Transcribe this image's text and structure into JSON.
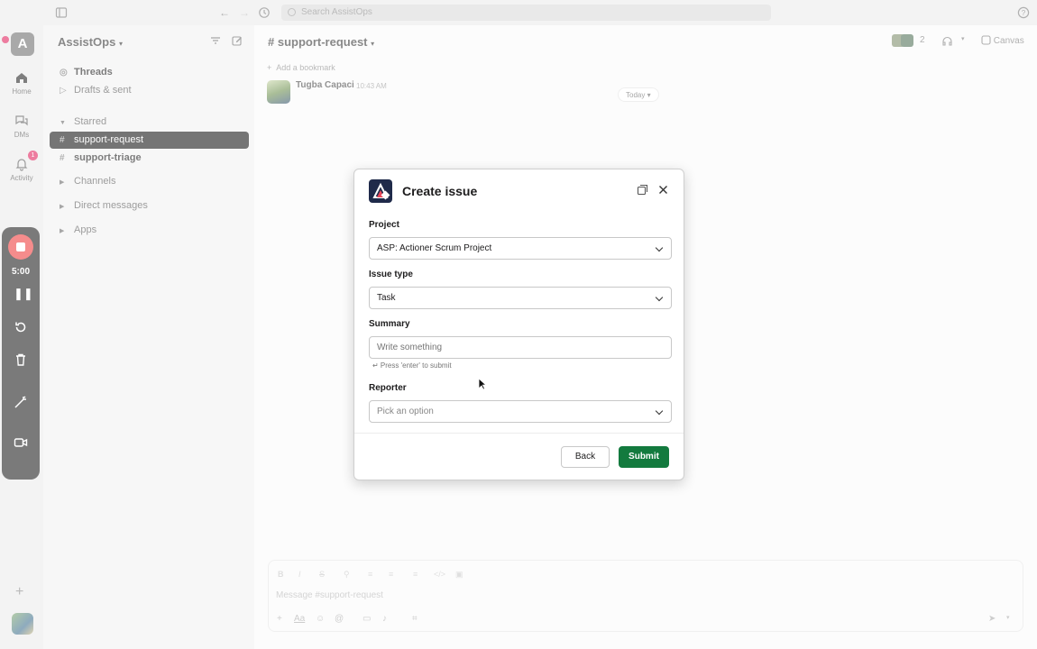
{
  "topbar": {
    "search_placeholder": "Search AssistOps"
  },
  "rail": {
    "workspace_initial": "A",
    "items": [
      {
        "label": "Home"
      },
      {
        "label": "DMs"
      },
      {
        "label": "Activity",
        "badge": "1"
      }
    ]
  },
  "recorder": {
    "time": "5:00"
  },
  "sidebar": {
    "workspace": "AssistOps",
    "nav": [
      {
        "label": "Threads"
      },
      {
        "label": "Drafts & sent"
      }
    ],
    "starred_label": "Starred",
    "starred": [
      {
        "label": "support-request"
      },
      {
        "label": "support-triage"
      }
    ],
    "sections": [
      {
        "label": "Channels"
      },
      {
        "label": "Direct messages"
      },
      {
        "label": "Apps"
      }
    ]
  },
  "channel": {
    "name": "# support-request",
    "member_count": "2",
    "canvas_label": "Canvas",
    "add_bookmark": "Add a bookmark",
    "message": {
      "author": "Tugba Capaci",
      "time": "10:43 AM"
    },
    "today_label": "Today",
    "composer_placeholder": "Message #support-request"
  },
  "modal": {
    "title": "Create issue",
    "fields": {
      "project": {
        "label": "Project",
        "value": "ASP: Actioner Scrum Project"
      },
      "issue_type": {
        "label": "Issue type",
        "value": "Task"
      },
      "summary": {
        "label": "Summary",
        "placeholder": "Write something",
        "hint": "↵ Press 'enter' to submit"
      },
      "reporter": {
        "label": "Reporter",
        "placeholder": "Pick an option"
      }
    },
    "back_label": "Back",
    "submit_label": "Submit",
    "submit_color": "#137a3e"
  }
}
